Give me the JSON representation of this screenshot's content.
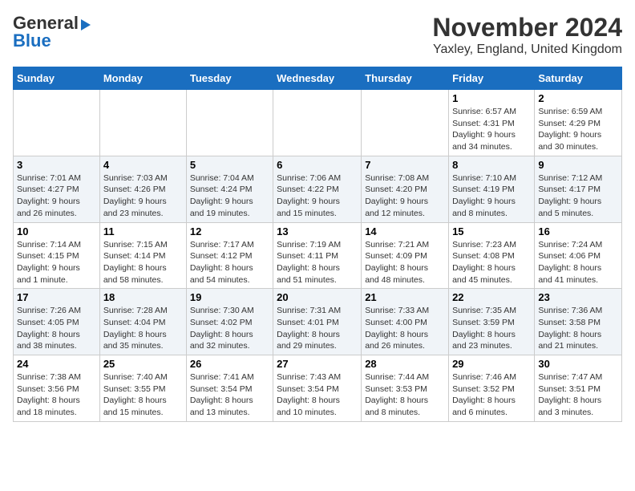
{
  "header": {
    "logo_line1": "General",
    "logo_line2": "Blue",
    "title": "November 2024",
    "subtitle": "Yaxley, England, United Kingdom"
  },
  "days_of_week": [
    "Sunday",
    "Monday",
    "Tuesday",
    "Wednesday",
    "Thursday",
    "Friday",
    "Saturday"
  ],
  "weeks": [
    [
      {
        "day": "",
        "info": ""
      },
      {
        "day": "",
        "info": ""
      },
      {
        "day": "",
        "info": ""
      },
      {
        "day": "",
        "info": ""
      },
      {
        "day": "",
        "info": ""
      },
      {
        "day": "1",
        "info": "Sunrise: 6:57 AM\nSunset: 4:31 PM\nDaylight: 9 hours\nand 34 minutes."
      },
      {
        "day": "2",
        "info": "Sunrise: 6:59 AM\nSunset: 4:29 PM\nDaylight: 9 hours\nand 30 minutes."
      }
    ],
    [
      {
        "day": "3",
        "info": "Sunrise: 7:01 AM\nSunset: 4:27 PM\nDaylight: 9 hours\nand 26 minutes."
      },
      {
        "day": "4",
        "info": "Sunrise: 7:03 AM\nSunset: 4:26 PM\nDaylight: 9 hours\nand 23 minutes."
      },
      {
        "day": "5",
        "info": "Sunrise: 7:04 AM\nSunset: 4:24 PM\nDaylight: 9 hours\nand 19 minutes."
      },
      {
        "day": "6",
        "info": "Sunrise: 7:06 AM\nSunset: 4:22 PM\nDaylight: 9 hours\nand 15 minutes."
      },
      {
        "day": "7",
        "info": "Sunrise: 7:08 AM\nSunset: 4:20 PM\nDaylight: 9 hours\nand 12 minutes."
      },
      {
        "day": "8",
        "info": "Sunrise: 7:10 AM\nSunset: 4:19 PM\nDaylight: 9 hours\nand 8 minutes."
      },
      {
        "day": "9",
        "info": "Sunrise: 7:12 AM\nSunset: 4:17 PM\nDaylight: 9 hours\nand 5 minutes."
      }
    ],
    [
      {
        "day": "10",
        "info": "Sunrise: 7:14 AM\nSunset: 4:15 PM\nDaylight: 9 hours\nand 1 minute."
      },
      {
        "day": "11",
        "info": "Sunrise: 7:15 AM\nSunset: 4:14 PM\nDaylight: 8 hours\nand 58 minutes."
      },
      {
        "day": "12",
        "info": "Sunrise: 7:17 AM\nSunset: 4:12 PM\nDaylight: 8 hours\nand 54 minutes."
      },
      {
        "day": "13",
        "info": "Sunrise: 7:19 AM\nSunset: 4:11 PM\nDaylight: 8 hours\nand 51 minutes."
      },
      {
        "day": "14",
        "info": "Sunrise: 7:21 AM\nSunset: 4:09 PM\nDaylight: 8 hours\nand 48 minutes."
      },
      {
        "day": "15",
        "info": "Sunrise: 7:23 AM\nSunset: 4:08 PM\nDaylight: 8 hours\nand 45 minutes."
      },
      {
        "day": "16",
        "info": "Sunrise: 7:24 AM\nSunset: 4:06 PM\nDaylight: 8 hours\nand 41 minutes."
      }
    ],
    [
      {
        "day": "17",
        "info": "Sunrise: 7:26 AM\nSunset: 4:05 PM\nDaylight: 8 hours\nand 38 minutes."
      },
      {
        "day": "18",
        "info": "Sunrise: 7:28 AM\nSunset: 4:04 PM\nDaylight: 8 hours\nand 35 minutes."
      },
      {
        "day": "19",
        "info": "Sunrise: 7:30 AM\nSunset: 4:02 PM\nDaylight: 8 hours\nand 32 minutes."
      },
      {
        "day": "20",
        "info": "Sunrise: 7:31 AM\nSunset: 4:01 PM\nDaylight: 8 hours\nand 29 minutes."
      },
      {
        "day": "21",
        "info": "Sunrise: 7:33 AM\nSunset: 4:00 PM\nDaylight: 8 hours\nand 26 minutes."
      },
      {
        "day": "22",
        "info": "Sunrise: 7:35 AM\nSunset: 3:59 PM\nDaylight: 8 hours\nand 23 minutes."
      },
      {
        "day": "23",
        "info": "Sunrise: 7:36 AM\nSunset: 3:58 PM\nDaylight: 8 hours\nand 21 minutes."
      }
    ],
    [
      {
        "day": "24",
        "info": "Sunrise: 7:38 AM\nSunset: 3:56 PM\nDaylight: 8 hours\nand 18 minutes."
      },
      {
        "day": "25",
        "info": "Sunrise: 7:40 AM\nSunset: 3:55 PM\nDaylight: 8 hours\nand 15 minutes."
      },
      {
        "day": "26",
        "info": "Sunrise: 7:41 AM\nSunset: 3:54 PM\nDaylight: 8 hours\nand 13 minutes."
      },
      {
        "day": "27",
        "info": "Sunrise: 7:43 AM\nSunset: 3:54 PM\nDaylight: 8 hours\nand 10 minutes."
      },
      {
        "day": "28",
        "info": "Sunrise: 7:44 AM\nSunset: 3:53 PM\nDaylight: 8 hours\nand 8 minutes."
      },
      {
        "day": "29",
        "info": "Sunrise: 7:46 AM\nSunset: 3:52 PM\nDaylight: 8 hours\nand 6 minutes."
      },
      {
        "day": "30",
        "info": "Sunrise: 7:47 AM\nSunset: 3:51 PM\nDaylight: 8 hours\nand 3 minutes."
      }
    ]
  ]
}
